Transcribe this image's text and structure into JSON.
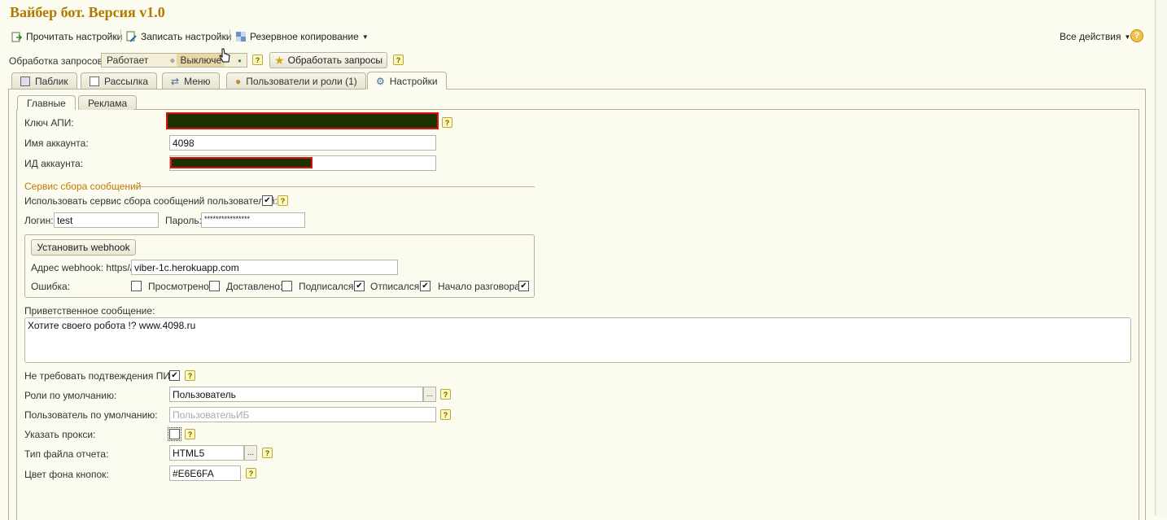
{
  "window_title": "Вайбер бот. Версия v1.0",
  "toolbar": {
    "read_settings": "Прочитать настройки",
    "write_settings": "Записать настройки",
    "backup": "Резервное копирование",
    "all_actions": "Все действия",
    "help": "?"
  },
  "processing": {
    "label": "Обработка запросов:",
    "works": "Работает",
    "off": "Выключе",
    "process_button": "Обработать запросы"
  },
  "tabs": [
    "Паблик",
    "Рассылка",
    "Меню",
    "Пользователи и роли (1)",
    "Настройки"
  ],
  "subtabs": [
    "Главные",
    "Реклама"
  ],
  "form": {
    "api_key_label": "Ключ АПИ:",
    "account_name_label": "Имя аккаунта:",
    "account_name_value": "4098",
    "account_id_label": "ИД аккаунта:",
    "group_title": "Сервис сбора сообщений",
    "use_service_label": "Использовать сервис сбора сообщений пользователей:",
    "login_label": "Логин:",
    "login_value": "test",
    "password_label": "Пароль:",
    "password_value": "****************",
    "set_webhook": "Установить webhook",
    "webhook_label": "Адрес webhook: https//:",
    "webhook_value": "viber-1c.herokuapp.com",
    "error_label": "Ошибка:",
    "viewed_label": "Просмотрено:",
    "delivered_label": "Доставлено:",
    "subscribed_label": "Подписался:",
    "unsubscribed_label": "Отписался:",
    "conversation_label": "Начало разговора:",
    "welcome_label": "Приветственное сообщение:",
    "welcome_value": "Хотите своего робота !? www.4098.ru",
    "no_pin_label": "Не требовать подтвеждения ПИН:",
    "default_roles_label": "Роли по умолчанию:",
    "default_roles_value": "Пользователь",
    "default_user_label": "Пользователь по умолчанию:",
    "default_user_placeholder": "ПользовательИБ",
    "proxy_label": "Указать прокси:",
    "report_type_label": "Тип файла отчета:",
    "report_type_value": "HTML5",
    "button_color_label": "Цвет фона кнопок:",
    "button_color_value": "#E6E6FA",
    "ellipsis": "..."
  },
  "checkboxes": {
    "use_service": true,
    "error": false,
    "viewed": false,
    "delivered": false,
    "subscribed": true,
    "unsubscribed": true,
    "conversation": true,
    "no_pin": true,
    "proxy": false
  },
  "colors": {
    "title": "#b07a00",
    "group_title": "#c07a00",
    "background": "#fbfbef",
    "redaction": "#1c3300",
    "redaction_border": "#dd1111"
  }
}
